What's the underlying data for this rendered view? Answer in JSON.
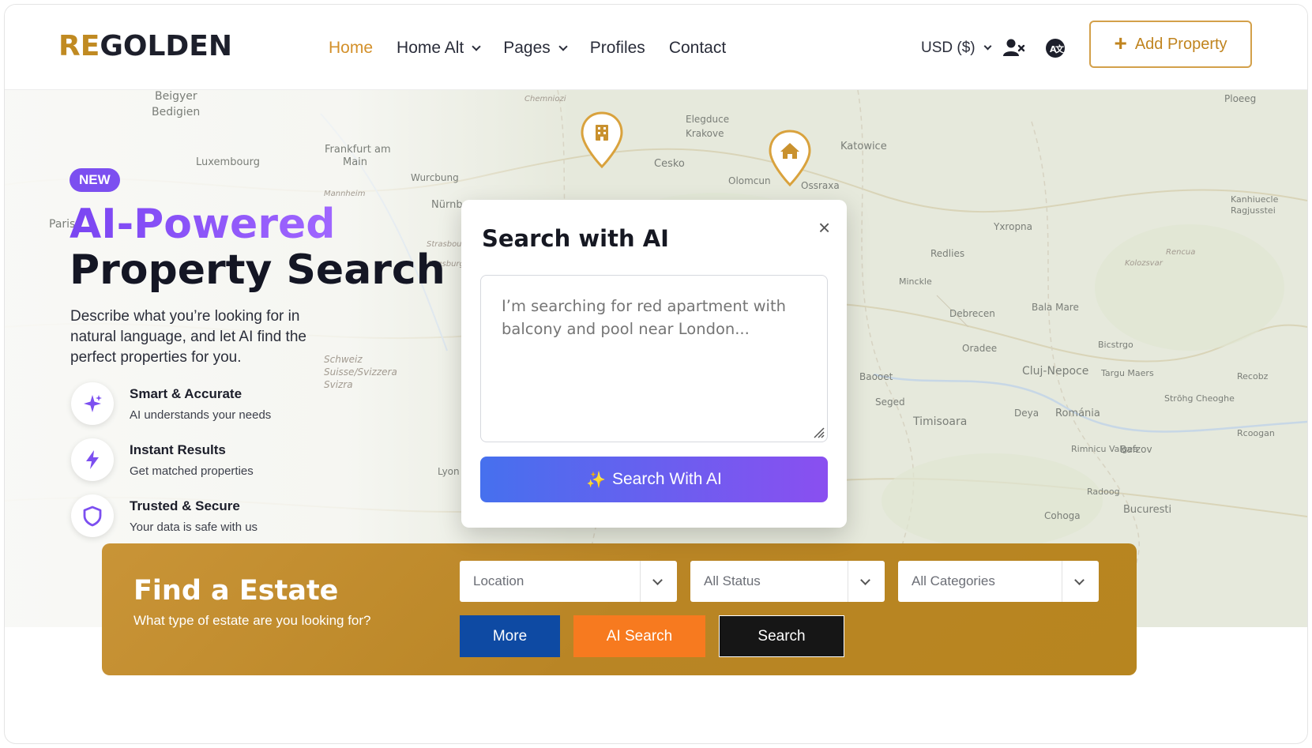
{
  "header": {
    "logo_re": "RE",
    "logo_golden": "GOLDEN",
    "nav": [
      {
        "label": "Home",
        "active": true,
        "has_dropdown": false
      },
      {
        "label": "Home Alt",
        "active": false,
        "has_dropdown": true
      },
      {
        "label": "Pages",
        "active": false,
        "has_dropdown": true
      },
      {
        "label": "Profiles",
        "active": false,
        "has_dropdown": false
      },
      {
        "label": "Contact",
        "active": false,
        "has_dropdown": false
      }
    ],
    "currency": "USD ($)",
    "user_icon": "user-x-icon",
    "language_icon": "globe-icon",
    "add_property_label": "Add Property"
  },
  "hero": {
    "badge": "NEW",
    "title_line1": "AI-Powered",
    "title_line2": "Property Search",
    "description": "Describe what you’re looking for in natural language, and let AI find the perfect properties for you.",
    "features": [
      {
        "icon": "sparkle-icon",
        "title": "Smart & Accurate",
        "subtitle": "AI understands your needs"
      },
      {
        "icon": "lightning-icon",
        "title": "Instant Results",
        "subtitle": "Get matched properties"
      },
      {
        "icon": "shield-icon",
        "title": "Trusted & Secure",
        "subtitle": "Your data is safe with us"
      }
    ],
    "map_labels": [
      "Beigyer",
      "Bedigien",
      "Luxembourg",
      "Frankfurt am",
      "Main",
      "Chemniozi",
      "Elegduce",
      "Krakove",
      "Cesko",
      "Olomcun",
      "Ossraxa",
      "Katowice",
      "Wurcbung",
      "Nürnberg",
      "Mannheim",
      "Paris",
      "Strasbour",
      "Augsburg",
      "Schweiz",
      "Suisse/Svizzera",
      "Svizra",
      "Redlies",
      "Minckle",
      "Debrecen",
      "Yxropna",
      "Bala Mare",
      "Oradee",
      "Cluj-Nepoce",
      "Timisoara",
      "Seged",
      "Baooet",
      "Románia",
      "Deya",
      "Bucuresti",
      "Cohoga",
      "Radoog",
      "Rimnicu Valgea",
      "Bafzov",
      "Bicstrgo",
      "Targu Maers",
      "Lyon",
      "Kanhiuecle",
      "Ragjusstei",
      "Ploeeg",
      "Kolozsvar",
      "Strōhg Cheoghe",
      "Rcoogan",
      "Rencua",
      "Recobz"
    ]
  },
  "pins": [
    {
      "icon": "building-icon"
    },
    {
      "icon": "home-icon"
    }
  ],
  "modal": {
    "title": "Search with AI",
    "close_label": "×",
    "placeholder": "I’m searching for red apartment with balcony and pool near London...",
    "button_label": "Search With AI",
    "button_icon": "sparkle-icon"
  },
  "find": {
    "title": "Find a Estate",
    "subtitle": "What type of estate are you looking for?",
    "location_value": "Location",
    "status_value": "All Status",
    "categories_value": "All Categories",
    "more_label": "More",
    "ai_search_label": "AI Search",
    "search_label": "Search"
  },
  "colors": {
    "gold": "#c08a22",
    "purple": "#7c4ff0",
    "more_blue": "#0e4aa3",
    "ai_orange": "#f77a1f",
    "search_black": "#161616"
  }
}
